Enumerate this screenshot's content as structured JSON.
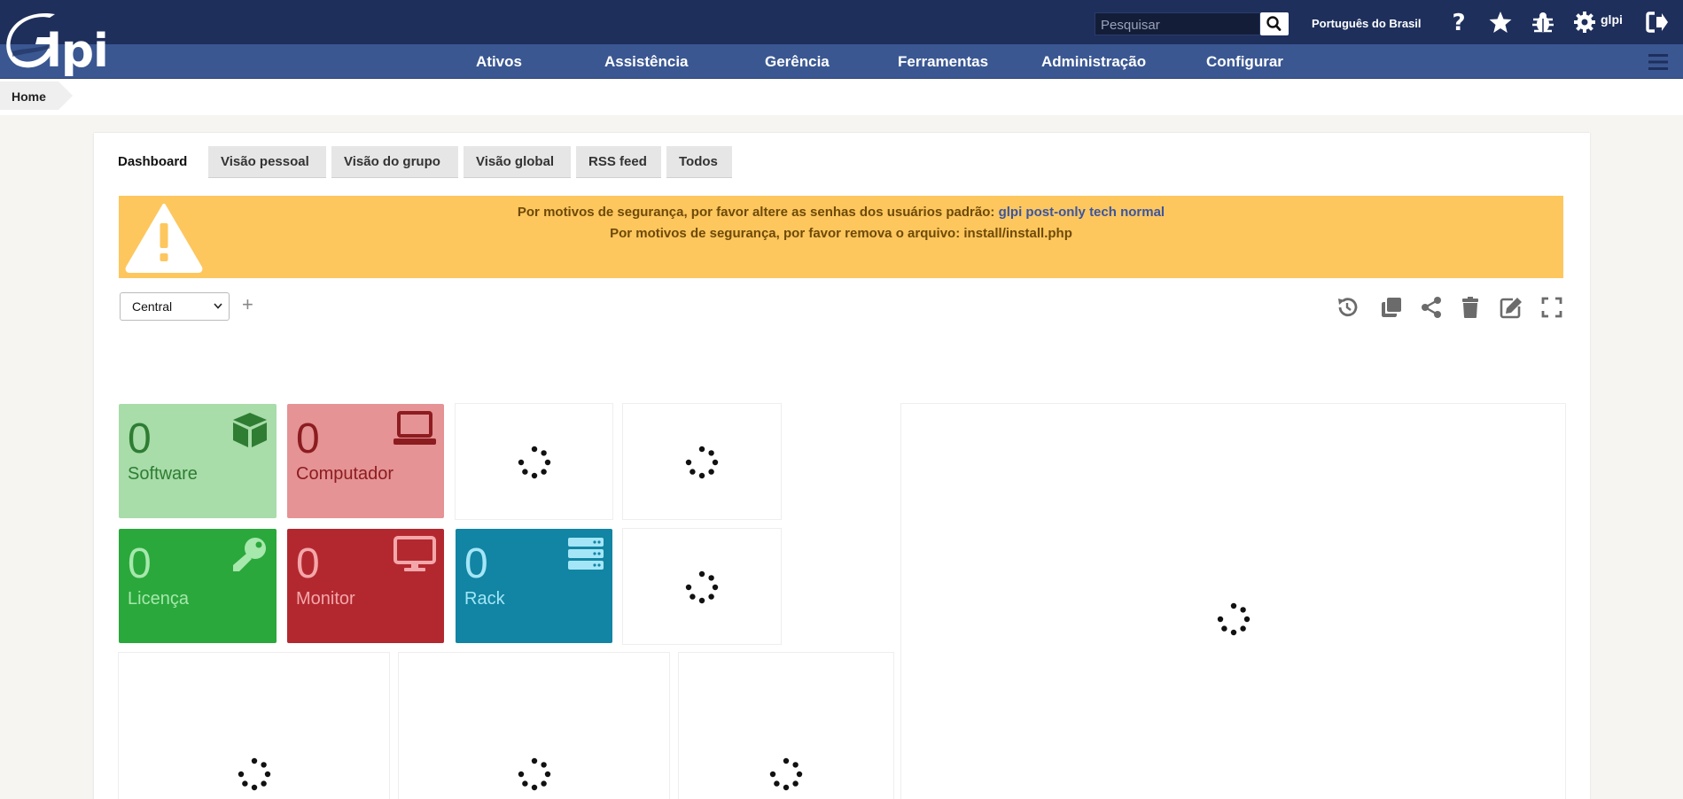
{
  "header": {
    "logo_text": "lpi",
    "search_placeholder": "Pesquisar",
    "language": "Português do Brasil",
    "user": "glpi",
    "icons": [
      "search-icon",
      "help-icon",
      "star-icon",
      "bug-icon",
      "gear-icon",
      "logout-icon"
    ]
  },
  "menu": [
    "Ativos",
    "Assistência",
    "Gerência",
    "Ferramentas",
    "Administração",
    "Configurar"
  ],
  "breadcrumb": "Home",
  "tabs": [
    "Dashboard",
    "Visão pessoal",
    "Visão do grupo",
    "Visão global",
    "RSS feed",
    "Todos"
  ],
  "alert": {
    "line1_text": "Por motivos de segurança, por favor altere as senhas dos usuários padrão: ",
    "line1_link": "glpi post-only tech normal",
    "line2": "Por motivos de segurança, por favor remova o arquivo: install/install.php"
  },
  "dashboard": {
    "selected": "Central",
    "add": "+",
    "toolbar_icons": [
      "history-icon",
      "clone-icon",
      "share-icon",
      "delete-icon",
      "edit-icon",
      "fullscreen-icon"
    ]
  },
  "cards": [
    {
      "value": "0",
      "label": "Software",
      "icon": "box-icon",
      "bg": "#a8dca9",
      "fg": "#2e7d32",
      "iconColor": "#2e7d32"
    },
    {
      "value": "0",
      "label": "Computador",
      "icon": "laptop-icon",
      "bg": "#e59395",
      "fg": "#8c1c20",
      "iconColor": "#8c1c20"
    },
    {
      "value": "0",
      "label": "Licença",
      "icon": "key-icon",
      "bg": "#2aa83c",
      "fg": "#a7e8ad",
      "iconColor": "#a7e8ad"
    },
    {
      "value": "0",
      "label": "Monitor",
      "icon": "monitor-icon",
      "bg": "#b3282f",
      "fg": "#f4a7aa",
      "iconColor": "#f4a7aa"
    },
    {
      "value": "0",
      "label": "Rack",
      "icon": "server-icon",
      "bg": "#1185a3",
      "fg": "#a4e6f7",
      "iconColor": "#a4e6f7"
    }
  ]
}
